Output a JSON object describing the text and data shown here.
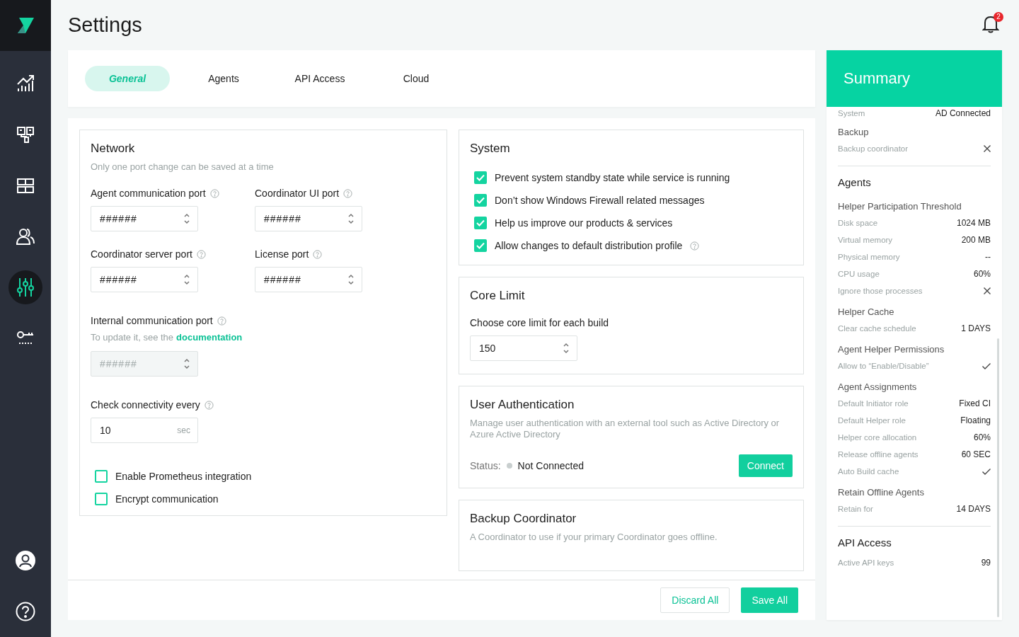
{
  "nav": [
    {
      "kind": "chart",
      "selected": false
    },
    {
      "kind": "nodes",
      "selected": false
    },
    {
      "kind": "grid",
      "selected": false
    },
    {
      "kind": "users",
      "selected": false
    },
    {
      "kind": "sliders",
      "selected": true
    },
    {
      "kind": "key",
      "selected": false
    }
  ],
  "nav_bottom": [
    {
      "kind": "profile"
    },
    {
      "kind": "help"
    }
  ],
  "page_title": "Settings",
  "notifications": "2",
  "tabs": [
    {
      "label": "General",
      "selected": true
    },
    {
      "label": "Agents",
      "selected": false
    },
    {
      "label": "API Access",
      "selected": false
    },
    {
      "label": "Cloud",
      "selected": false
    }
  ],
  "network": {
    "title": "Network",
    "subtitle": "Only one port change can be saved at a time",
    "ports": [
      {
        "label": "Agent communication port",
        "value": "######",
        "help": true
      },
      {
        "label": "Coordinator UI port",
        "value": "######",
        "help": true
      },
      {
        "label": "Coordinator server port",
        "value": "######",
        "help": true
      },
      {
        "label": "License port",
        "value": "######",
        "help": true
      }
    ],
    "internal_port": {
      "label": "Internal communication port",
      "help": true,
      "note": "To update it, see the",
      "link": "documentation",
      "value": "######",
      "disabled": true
    },
    "connectivity": {
      "label": "Check connectivity every",
      "help": true,
      "value": "10",
      "unit": "sec"
    },
    "options": [
      {
        "label": "Enable Prometheus integration",
        "checked": false
      },
      {
        "label": "Encrypt communication",
        "checked": false
      }
    ]
  },
  "system": {
    "title": "System",
    "options": [
      {
        "label": "Prevent system standby state while service is running",
        "checked": true,
        "help": false
      },
      {
        "label": "Don’t show Windows Firewall related messages",
        "checked": true,
        "help": false
      },
      {
        "label": "Help us improve our products & services",
        "checked": true,
        "help": false
      },
      {
        "label": "Allow changes to default distribution profile",
        "checked": true,
        "help": true
      }
    ]
  },
  "core_limit": {
    "title": "Core Limit",
    "label": "Choose core limit for each build",
    "value": "150"
  },
  "user_auth": {
    "title": "User Authentication",
    "description": "Manage user authentication with an external tool such as Active Directory or Azure Active Directory",
    "status_label": "Status:",
    "status": "Not Connected",
    "button": "Connect"
  },
  "backup": {
    "title": "Backup Coordinator",
    "description": "A Coordinator to use if your primary Coordinator goes offline."
  },
  "footer": {
    "discard": "Discard All",
    "save": "Save All"
  },
  "summary": {
    "title": "Summary",
    "items": [
      {
        "kind": "row",
        "label": "System",
        "value": "AD Connected"
      },
      {
        "kind": "subheading",
        "label": "Backup"
      },
      {
        "kind": "cross-row",
        "label": "Backup coordinator"
      },
      {
        "kind": "divider"
      },
      {
        "kind": "heading",
        "label": "Agents"
      },
      {
        "kind": "subheading",
        "label": "Helper Participation Threshold"
      },
      {
        "kind": "row",
        "label": "Disk space",
        "value": "1024 MB"
      },
      {
        "kind": "row",
        "label": "Virtual memory",
        "value": "200 MB"
      },
      {
        "kind": "row",
        "label": "Physical memory",
        "value": "--"
      },
      {
        "kind": "row",
        "label": "CPU usage",
        "value": "60%"
      },
      {
        "kind": "cross-row",
        "label": "Ignore those processes"
      },
      {
        "kind": "subheading",
        "label": "Helper Cache"
      },
      {
        "kind": "row",
        "label": "Clear cache schedule",
        "value": "1 DAYS"
      },
      {
        "kind": "subheading",
        "label": "Agent Helper Permissions"
      },
      {
        "kind": "check-row",
        "label": "Allow to “Enable/Disable”"
      },
      {
        "kind": "subheading",
        "label": "Agent Assignments"
      },
      {
        "kind": "row",
        "label": "Default Initiator role",
        "value": "Fixed CI"
      },
      {
        "kind": "row",
        "label": "Default Helper role",
        "value": "Floating"
      },
      {
        "kind": "row",
        "label": "Helper core allocation",
        "value": "60%"
      },
      {
        "kind": "row",
        "label": "Release offline agents",
        "value": "60 SEC"
      },
      {
        "kind": "check-row",
        "label": "Auto Build cache"
      },
      {
        "kind": "subheading",
        "label": "Retain Offline Agents"
      },
      {
        "kind": "row",
        "label": "Retain for",
        "value": "14 DAYS"
      },
      {
        "kind": "divider"
      },
      {
        "kind": "heading",
        "label": "API Access"
      },
      {
        "kind": "row",
        "label": "Active API keys",
        "value": "99"
      }
    ]
  }
}
